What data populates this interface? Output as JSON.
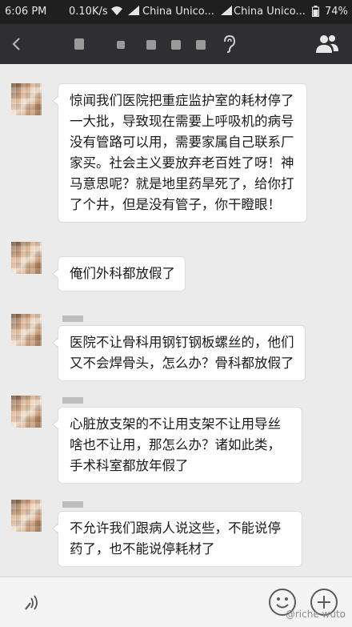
{
  "status_bar": {
    "time": "6:06 PM",
    "speed": "0.10K/s",
    "carrier1": "China Unico...",
    "carrier2": "China Unico...",
    "battery": "74%"
  },
  "header": {
    "group_icon": "people-icon",
    "voice_icon": "ear-icon"
  },
  "messages": [
    {
      "text": "惊闻我们医院把重症监护室的耗材停了一大批，导致现在需要上呼吸机的病号没有管路可以用，需要家属自己联系厂家买。社会主义要放弃老百姓了呀！神马意思呢？就是地里药旱死了，给你打了个井，但是没有管子，你干瞪眼！"
    },
    {
      "text": "俺们外科都放假了"
    },
    {
      "text": "医院不让骨科用钢钉钢板螺丝的，他们又不会焊骨头，怎么办？骨科都放假了"
    },
    {
      "text": "心脏放支架的不让用支架不让用导丝啥也不让用，那怎么办？诸如此类，手术科室都放年假了"
    },
    {
      "text": "不允许我们跟病人说这些，不能说停药了，也不能说停耗材了"
    }
  ],
  "input_bar": {
    "voice_icon": "voice-wave-icon",
    "emoji_icon": "emoji-icon",
    "plus_icon": "plus-icon"
  },
  "watermark": "@riche wuto"
}
